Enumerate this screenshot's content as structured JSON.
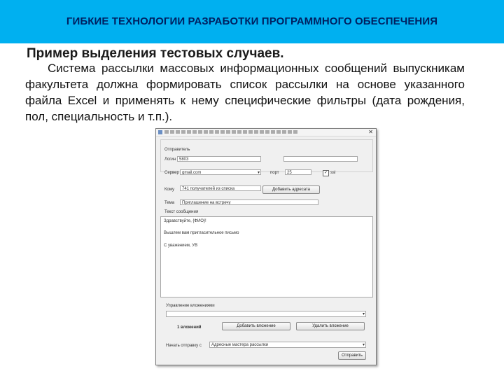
{
  "header": {
    "title": "ГИБКИЕ ТЕХНОЛОГИИ РАЗРАБОТКИ ПРОГРАММНОГО ОБЕСПЕЧЕНИЯ"
  },
  "slide": {
    "subtitle": "Пример выделения тестовых случаев.",
    "paragraph": "Система рассылки массовых информационных сообщений выпускникам факультета должна формировать список рассылки на основе указанного файла Excel и применять к нему специфические фильтры (дата рождения, пол, специальность и т.п.)."
  },
  "dialog": {
    "group_label": "Отправитель",
    "login_label": "Логин",
    "login_value": "5803",
    "server_label": "Сервер",
    "server_value": "gmail.com",
    "port_label": "порт",
    "port_value": "25",
    "ssl_label": "ssl",
    "ssl_checked": "✓",
    "to_label": "Кому",
    "to_value": "741 получателей из списка",
    "to_button": "Добавить адресата",
    "subject_label": "Тема",
    "subject_value": "Приглашение на встречу",
    "body_label": "Текст сообщения",
    "body_lines": [
      "Здравствуйте, {ФИО}!",
      "Вышлем вам пригласительное письмо",
      "С уважением, УВ"
    ],
    "attachments_label": "Управление вложениями",
    "attachments_count": "1 вложений",
    "add_attachment_button": "Добавить вложение",
    "remove_attachment_button": "Удалить вложение",
    "send_label": "Начать отправку с",
    "send_value": "Адресные мастера рассылки",
    "send_button": "Отправить"
  }
}
